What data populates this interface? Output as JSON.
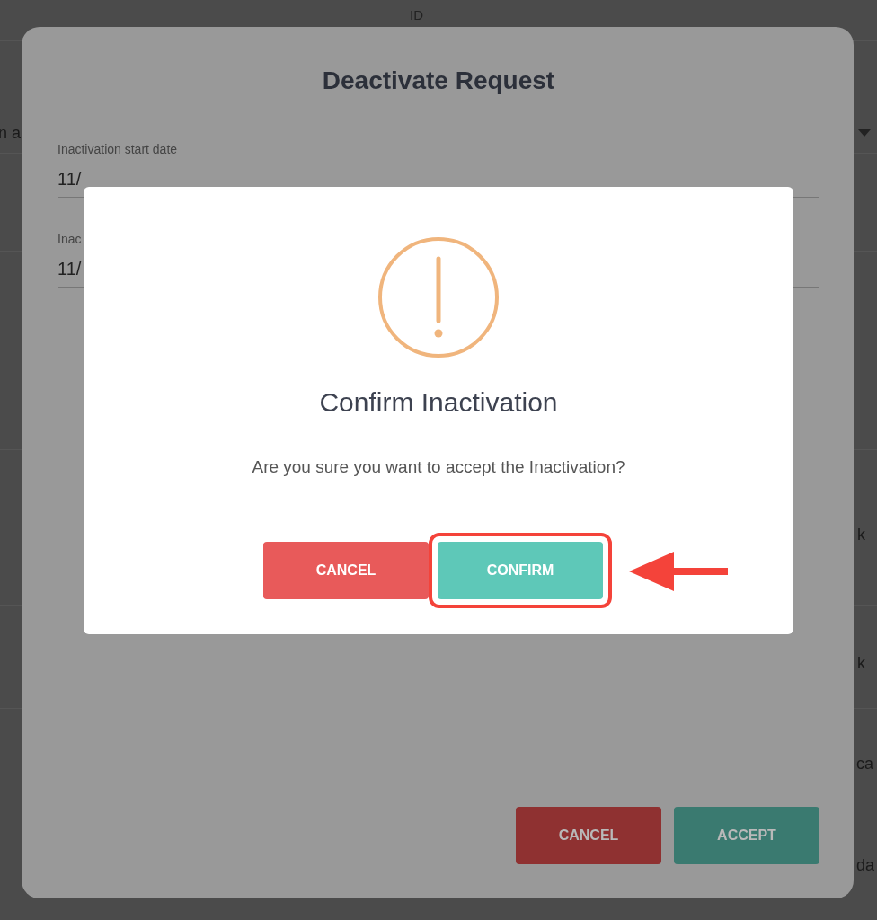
{
  "background_page": {
    "column_header": "ID",
    "fragments": [
      "n a",
      "k",
      "k",
      "ca",
      "da"
    ]
  },
  "deactivate_dialog": {
    "title": "Deactivate Request",
    "fields": [
      {
        "label": "Inactivation start date",
        "value": "11/"
      },
      {
        "label": "Inac",
        "value": "11/"
      }
    ],
    "buttons": [
      {
        "label": "CANCEL",
        "kind": "cancel"
      },
      {
        "label": "ACCEPT",
        "kind": "accept"
      }
    ]
  },
  "confirm_dialog": {
    "title": "Confirm Inactivation",
    "message": "Are you sure you want to accept the Inactivation?",
    "buttons": [
      {
        "label": "CANCEL",
        "kind": "cancel",
        "highlighted": false
      },
      {
        "label": "CONFIRM",
        "kind": "confirm",
        "highlighted": true
      }
    ]
  }
}
